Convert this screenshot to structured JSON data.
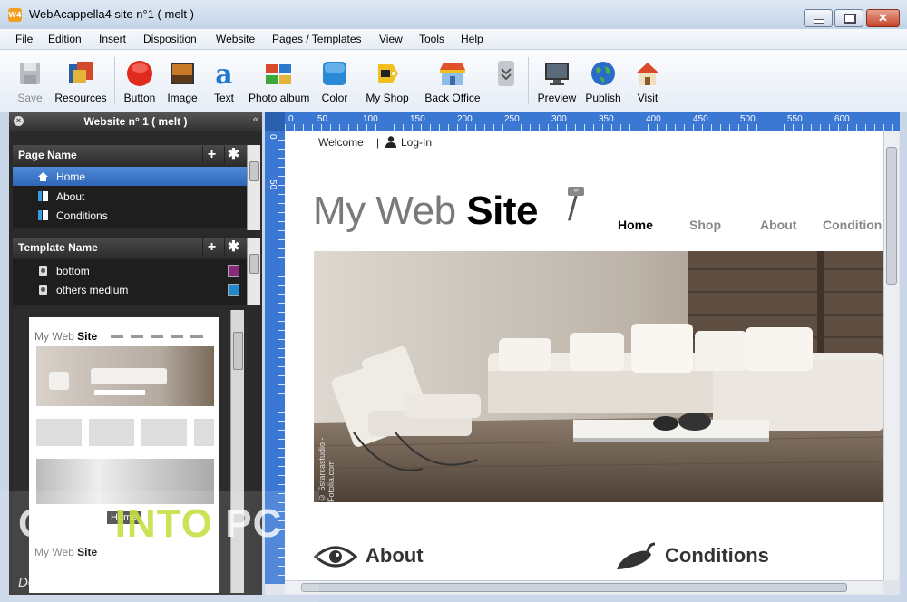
{
  "window": {
    "title": "WebAcappella4 site n°1 ( melt )",
    "app_icon_text": "W4"
  },
  "menu": [
    "File",
    "Edition",
    "Insert",
    "Disposition",
    "Website",
    "Pages / Templates",
    "View",
    "Tools",
    "Help"
  ],
  "toolbar": {
    "save": "Save",
    "resources": "Resources",
    "button": "Button",
    "image": "Image",
    "text": "Text",
    "photo_album": "Photo album",
    "color": "Color",
    "my_shop": "My Shop",
    "back_office": "Back Office",
    "preview": "Preview",
    "publish": "Publish",
    "visit": "Visit"
  },
  "panel": {
    "title": "Website n° 1 ( melt )",
    "pages_header": "Page Name",
    "pages": [
      "Home",
      "About",
      "Conditions"
    ],
    "templates_header": "Template Name",
    "templates": [
      {
        "name": "bottom",
        "color": "#8a2a7a"
      },
      {
        "name": "others medium",
        "color": "#1e8ad0"
      }
    ],
    "thumb": {
      "logo_regular": "My Web ",
      "logo_bold": "Site",
      "home_tag": "Home"
    }
  },
  "ruler": {
    "h": [
      "0",
      "50",
      "100",
      "150",
      "200",
      "250",
      "300",
      "350",
      "400",
      "450",
      "500",
      "550",
      "600"
    ],
    "v": [
      "0",
      "50"
    ]
  },
  "site": {
    "welcome": "Welcome",
    "separator": "|",
    "login": "Log-In",
    "logo_regular": "My Web ",
    "logo_bold": "Site",
    "nav": [
      "Home",
      "Shop",
      "About",
      "Condition"
    ],
    "hero_credit": "© 5starcastudio - Fotolia.com",
    "section_about": "About",
    "section_conditions": "Conditions"
  },
  "watermark": {
    "get": "GET ",
    "into": "INTO",
    "pc": " PC",
    "sub": "Download Free Your Desired App"
  },
  "colors": {
    "selection": "#3a76c8",
    "ruler": "#3a78d4"
  }
}
